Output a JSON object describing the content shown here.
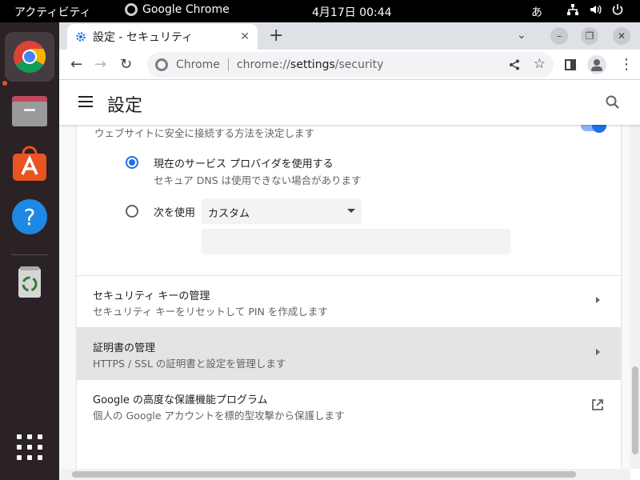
{
  "topbar": {
    "activities": "アクティビティ",
    "app_name": "Google Chrome",
    "clock": "4月17日  00:44",
    "ime": "あ"
  },
  "browser": {
    "tab_title": "設定 - セキュリティ",
    "omnibox": {
      "site_label": "Chrome",
      "url_prefix": "chrome://",
      "url_host": "settings",
      "url_path": "/security"
    }
  },
  "settings": {
    "header_title": "設定",
    "secure_dns": {
      "description": "ウェブサイトに安全に接続する方法を決定します",
      "enabled": true,
      "option_current": {
        "label": "現在のサービス プロバイダを使用する",
        "sublabel": "セキュア DNS は使用できない場合があります",
        "selected": true
      },
      "option_custom": {
        "label": "次を使用",
        "select_value": "カスタム",
        "input_value": ""
      }
    },
    "rows": [
      {
        "title": "セキュリティ キーの管理",
        "subtitle": "セキュリティ キーをリセットして PIN を作成します"
      },
      {
        "title": "証明書の管理",
        "subtitle": "HTTPS / SSL の証明書と設定を管理します"
      },
      {
        "title": "Google の高度な保護機能プログラム",
        "subtitle": "個人の Google アカウントを標的型攻撃から保護します"
      }
    ]
  },
  "colors": {
    "accent": "#1a73e8",
    "ubuntu_orange": "#e95420",
    "dock_bg": "#2b2226"
  }
}
